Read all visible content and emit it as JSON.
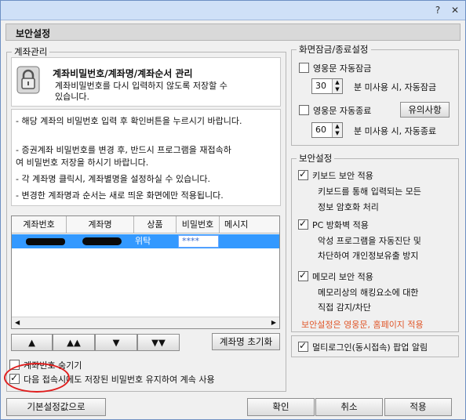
{
  "window": {
    "help": "?",
    "close": "✕"
  },
  "banner": {
    "title": "보안설정"
  },
  "account_group": {
    "title": "계좌관리",
    "header_title": "계좌비밀번호/계좌명/계좌순서 관리",
    "header_desc_1": "계좌비밀번호를 다시 입력하지 않도록 저장할 수",
    "header_desc_2": "있습니다.",
    "notes": [
      "- 해당 계좌의 비밀번호 입력 후 확인버튼을 누르시기 바랍니다.",
      "- 증권계좌 비밀번호를 변경 후, 반드시 프로그램을 재접속하",
      "  여 비밀번호 저장을 하시기 바랍니다.",
      "- 각 계좌명 클릭시, 계좌별명을 설정하실 수 있습니다.",
      "- 변경한 계좌명과 순서는 새로 띄운 화면에만 적용됩니다."
    ],
    "columns": [
      "계좌번호",
      "계좌명",
      "상품",
      "비밀번호",
      "메시지"
    ],
    "row": {
      "product": "위탁",
      "password": "****"
    },
    "order_buttons": [
      "▲",
      "▲▲",
      "▼",
      "▼▼"
    ],
    "reset_name_button": "계좌명 초기화",
    "hide_password_label": "계좌번호 숨기기",
    "keep_password_label": "다음 접속시에도 저장된 비밀번호 유지하여 계속 사용"
  },
  "lock_group": {
    "title": "화면잠금/종료설정",
    "lock_label": "영웅문 자동잠금",
    "lock_minutes": "30",
    "lock_suffix": "분 미사용 시, 자동잠금",
    "exit_label": "영웅문 자동종료",
    "notice_button": "유의사항",
    "exit_minutes": "60",
    "exit_suffix": "분 미사용 시, 자동종료"
  },
  "security_group": {
    "title": "보안설정",
    "keyboard_label": "키보드 보안 적용",
    "keyboard_desc_1": "키보드를 통해 입력되는 모든",
    "keyboard_desc_2": "정보 암호화 처리",
    "firewall_label": "PC 방화벽 적용",
    "firewall_desc_1": "악성 프로그램을 자동진단 및",
    "firewall_desc_2": "차단하여 개인정보유출 방지",
    "memory_label": "메모리 보안 적용",
    "memory_desc_1": "메모리상의 해킹요소에 대한",
    "memory_desc_2": "직접 감지/차단",
    "footer_note": "보안설정은 영웅문, 홈페이지 적용"
  },
  "multi_login_label": "멀티로그인(동시접속) 팝업 알림",
  "buttons": {
    "defaults": "기본설정값으로",
    "ok": "확인",
    "cancel": "취소",
    "apply": "적용"
  }
}
